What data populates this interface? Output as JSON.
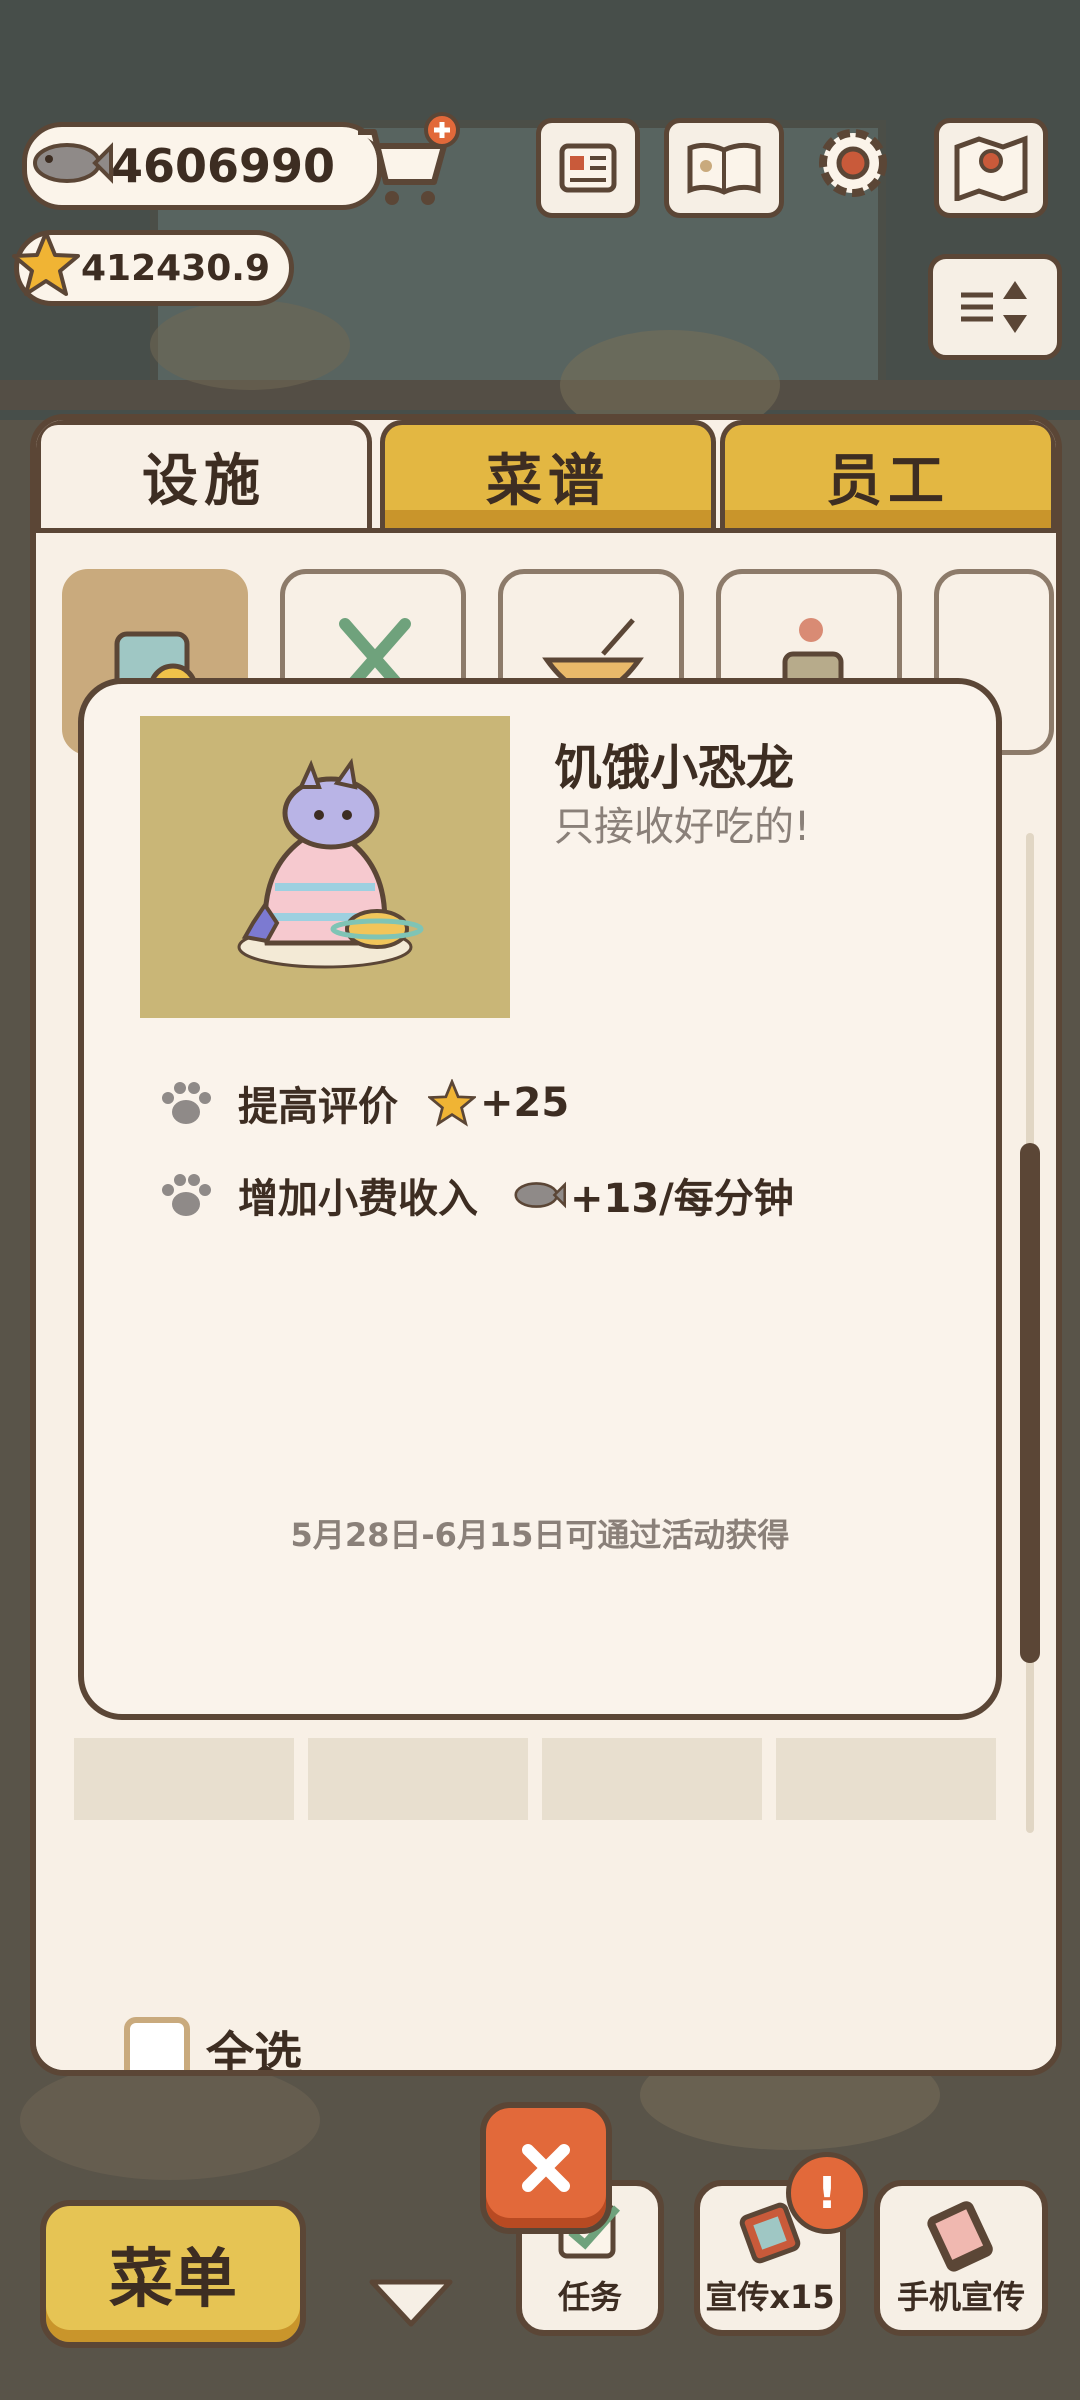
{
  "currency": {
    "fish": "4606990",
    "stars": "412430.9"
  },
  "tabs": {
    "facilities": "设施",
    "recipes": "菜谱",
    "staff": "员工"
  },
  "popup": {
    "item_name": "饥饿小恐龙",
    "item_desc": "只接收好吃的!",
    "stat1_label": "提高评价",
    "stat1_value": "+25",
    "stat2_label": "增加小费收入",
    "stat2_value": "+13/每分钟",
    "footnote": "5月28日-6月15日可通过活动获得"
  },
  "select_all": "全选",
  "bottom": {
    "menu": "菜单",
    "task": "任务",
    "promo": "宣传x15",
    "phone_promo": "手机宣传",
    "alert": "!"
  },
  "colors": {
    "outline": "#5b4636",
    "tab_gold": "#e3b742",
    "panel": "#f8f0e6",
    "close": "#e2693a"
  }
}
